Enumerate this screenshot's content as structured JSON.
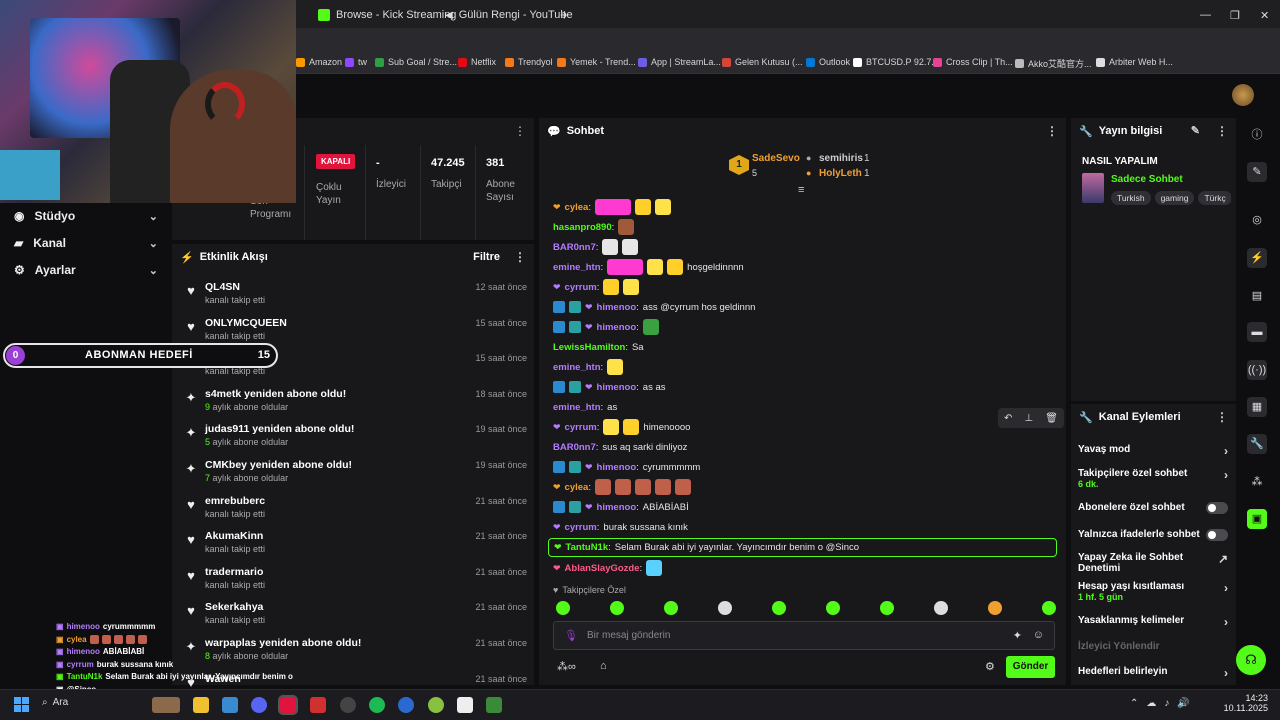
{
  "browser": {
    "tabs": [
      {
        "label": "Browse - Kick Streaming",
        "color": "#53fc18"
      },
      {
        "label": "Gülün Rengi - YouTube",
        "color": "#ffffff"
      }
    ],
    "new_tab": "+",
    "window_controls": {
      "minimize": "—",
      "restore": "❐",
      "close": "✕"
    },
    "bookmarks": [
      {
        "label": "Amazon",
        "color": "#ff9900"
      },
      {
        "label": "tw",
        "color": "#9146ff"
      },
      {
        "label": "Sub Goal / Stre...",
        "color": "#2f9e44"
      },
      {
        "label": "Netflix",
        "color": "#e50914"
      },
      {
        "label": "Trendyol",
        "color": "#f27a1a"
      },
      {
        "label": "Yemek - Trend...",
        "color": "#f27a1a"
      },
      {
        "label": "App | StreamLa...",
        "color": "#6c5ce7"
      },
      {
        "label": "Gelen Kutusu (...",
        "color": "#d44638"
      },
      {
        "label": "Outlook",
        "color": "#0078d4"
      },
      {
        "label": "BTCUSD.P 92.7...",
        "color": "#ffffff"
      },
      {
        "label": "Cross Clip | Th...",
        "color": "#e84393"
      },
      {
        "label": "Akko艾酷官方...",
        "color": "#bbbbbb"
      },
      {
        "label": "Arbiter Web H...",
        "color": "#dddddd"
      }
    ]
  },
  "sidebar": {
    "items": [
      {
        "label": "Stüdyo",
        "icon": "studio-icon"
      },
      {
        "label": "Kanal",
        "icon": "channel-icon"
      },
      {
        "label": "Ayarlar",
        "icon": "gear-icon"
      }
    ],
    "goal": {
      "current": "0",
      "title": "ABONMAN HEDEFİ",
      "target": "15"
    },
    "partial_label": "Son\nProgramı"
  },
  "stats": {
    "status_badge": "KAPALI",
    "status_label": "Çoklu\nYayın",
    "viewers_value": "-",
    "viewers_label": "İzleyici",
    "followers_value": "47.245",
    "followers_label": "Takipçi",
    "subs_value": "381",
    "subs_label": "Abone\nSayısı"
  },
  "activity": {
    "title": "Etkinlik Akışı",
    "filter": "Filtre",
    "items": [
      {
        "name": "QL4SN",
        "sub": "kanalı takip etti",
        "time": "12 saat önce",
        "type": "follow"
      },
      {
        "name": "ONLYMCQUEEN",
        "sub": "kanalı takip etti",
        "time": "15 saat önce",
        "type": "follow"
      },
      {
        "name": "memetto",
        "sub": "kanalı takip etti",
        "time": "15 saat önce",
        "type": "follow"
      },
      {
        "name": "s4metk yeniden abone oldu!",
        "months": "9",
        "sub": "aylık abone oldular",
        "time": "18 saat önce",
        "type": "sub"
      },
      {
        "name": "judas911 yeniden abone oldu!",
        "months": "5",
        "sub": "aylık abone oldular",
        "time": "19 saat önce",
        "type": "sub"
      },
      {
        "name": "CMKbey yeniden abone oldu!",
        "months": "7",
        "sub": "aylık abone oldular",
        "time": "19 saat önce",
        "type": "sub"
      },
      {
        "name": "emrebuberc",
        "sub": "kanalı takip etti",
        "time": "21 saat önce",
        "type": "follow"
      },
      {
        "name": "AkumaKinn",
        "sub": "kanalı takip etti",
        "time": "21 saat önce",
        "type": "follow"
      },
      {
        "name": "tradermario",
        "sub": "kanalı takip etti",
        "time": "21 saat önce",
        "type": "follow"
      },
      {
        "name": "Sekerkahya",
        "sub": "kanalı takip etti",
        "time": "21 saat önce",
        "type": "follow"
      },
      {
        "name": "warpaplas yeniden abone oldu!",
        "months": "8",
        "sub": "aylık abone oldular",
        "time": "21 saat önce",
        "type": "sub"
      },
      {
        "name": "Wawen",
        "sub": "",
        "time": "21 saat önce",
        "type": "follow"
      }
    ]
  },
  "chat": {
    "title": "Sohbet",
    "top_gifters": [
      {
        "rank": "1",
        "name": "SadeSevo",
        "count": "5"
      },
      {
        "name": "semihiris",
        "count": "1"
      },
      {
        "name": "HolyLeth",
        "count": "1"
      }
    ],
    "messages": [
      {
        "user": "cylea",
        "color": "#f0a030",
        "text": "",
        "emotes": [
          "#ff3ad0",
          "#ffd02a",
          "#ffe14a"
        ]
      },
      {
        "user": "hasanpro890",
        "color": "#53fc18",
        "text": "",
        "emotes": [
          "#a05a3a"
        ]
      },
      {
        "user": "BAR0nn7",
        "color": "#b47cff",
        "text": "",
        "emotes": [
          "#e6e6e6",
          "#e6e6e6"
        ]
      },
      {
        "user": "emine_htn",
        "color": "#b47cff",
        "text": "hoşgeldinnnn",
        "emotes": [
          "#ff3ad0",
          "#ffe14a",
          "#ffd02a"
        ]
      },
      {
        "user": "cyrrum",
        "color": "#b47cff",
        "text": "",
        "emotes": [
          "#ffd02a",
          "#ffe14a"
        ]
      },
      {
        "user": "himenoo",
        "color": "#b47cff",
        "text": "ass @cyrrum hos geldinnn",
        "emotes": []
      },
      {
        "user": "himenoo",
        "color": "#b47cff",
        "text": "",
        "emotes": [
          "#3aa040"
        ]
      },
      {
        "user": "LewissHamilton",
        "color": "#53fc18",
        "text": "Sa",
        "emotes": []
      },
      {
        "user": "emine_htn",
        "color": "#b47cff",
        "text": "",
        "emotes": [
          "#ffe14a"
        ]
      },
      {
        "user": "himenoo",
        "color": "#b47cff",
        "text": "as as",
        "emotes": []
      },
      {
        "user": "emine_htn",
        "color": "#b47cff",
        "text": "as",
        "emotes": []
      },
      {
        "user": "cyrrum",
        "color": "#b47cff",
        "text": "himenoooo",
        "emotes": [
          "#ffe14a",
          "#ffd02a"
        ]
      },
      {
        "user": "BAR0nn7",
        "color": "#b47cff",
        "text": "sus aq sarki dinliyoz",
        "emotes": []
      },
      {
        "user": "himenoo",
        "color": "#b47cff",
        "text": "cyrummmmm",
        "emotes": []
      },
      {
        "user": "cylea",
        "color": "#f0a030",
        "text": "",
        "emotes": [
          "#c0604a",
          "#c0604a",
          "#c0604a",
          "#c0604a",
          "#c0604a"
        ]
      },
      {
        "user": "himenoo",
        "color": "#b47cff",
        "text": "ABİABİABİ",
        "emotes": []
      },
      {
        "user": "cyrrum",
        "color": "#b47cff",
        "text": "burak sussana kınık",
        "emotes": []
      },
      {
        "user": "TantuN1k",
        "color": "#53fc18",
        "text": "Selam Burak abi iyi yayınlar. Yayıncımdır benim o @Sinco",
        "emotes": []
      },
      {
        "user": "AbIanSlayGozde",
        "color": "#ff5a8a",
        "text": "",
        "emotes": [
          "#5ad0ff"
        ]
      }
    ],
    "followers_only_label": "Takipçilere Özel",
    "input_placeholder": "Bir mesaj gönderin",
    "send_label": "Gönder"
  },
  "stream_info": {
    "title": "Yayın bilgisi",
    "stream_title": "NASIL YAPALIM",
    "category": "Sadece Sohbet",
    "tags": [
      "Turkish",
      "gaming",
      "Türkç"
    ]
  },
  "channel_actions": {
    "title": "Kanal Eylemleri",
    "items": [
      {
        "label": "Yavaş mod",
        "sub": "",
        "kind": "chevron"
      },
      {
        "label": "Takipçilere özel sohbet",
        "sub": "6 dk.",
        "kind": "chevron"
      },
      {
        "label": "Abonelere özel sohbet",
        "sub": "",
        "kind": "toggle"
      },
      {
        "label": "Yalnızca ifadelerle sohbet",
        "sub": "",
        "kind": "toggle"
      },
      {
        "label": "Yapay Zeka ile Sohbet Denetimi",
        "sub": "",
        "kind": "external"
      },
      {
        "label": "Hesap yaşı kısıtlaması",
        "sub": "1 hf. 5 gün",
        "kind": "chevron"
      },
      {
        "label": "Yasaklanmış kelimeler",
        "sub": "",
        "kind": "chevron"
      },
      {
        "label": "İzleyici Yönlendir",
        "sub": "",
        "kind": "disabled"
      },
      {
        "label": "Hedefleri belirleyin",
        "sub": "",
        "kind": "chevron"
      }
    ]
  },
  "overlay_chat": [
    {
      "user": "himenoo",
      "text": "cyrummmmm",
      "color": "#b47cff"
    },
    {
      "user": "cylea",
      "text": "",
      "color": "#f0a030"
    },
    {
      "user": "himenoo",
      "text": "ABİABİABİ",
      "color": "#b47cff"
    },
    {
      "user": "cyrrum",
      "text": "burak sussana kınık",
      "color": "#b47cff"
    },
    {
      "user": "TantuN1k",
      "text": "Selam Burak abi iyi yayınlar. Yayıncımdır benim o",
      "color": "#53fc18"
    },
    {
      "user": "",
      "text": "@Sinco",
      "color": "#ffffff"
    },
    {
      "user": "AbIanSlayGozde",
      "text": "",
      "color": "#ff5a8a"
    }
  ],
  "taskbar": {
    "search_label": "Ara",
    "time": "14:23",
    "date": "10.11.2025"
  }
}
